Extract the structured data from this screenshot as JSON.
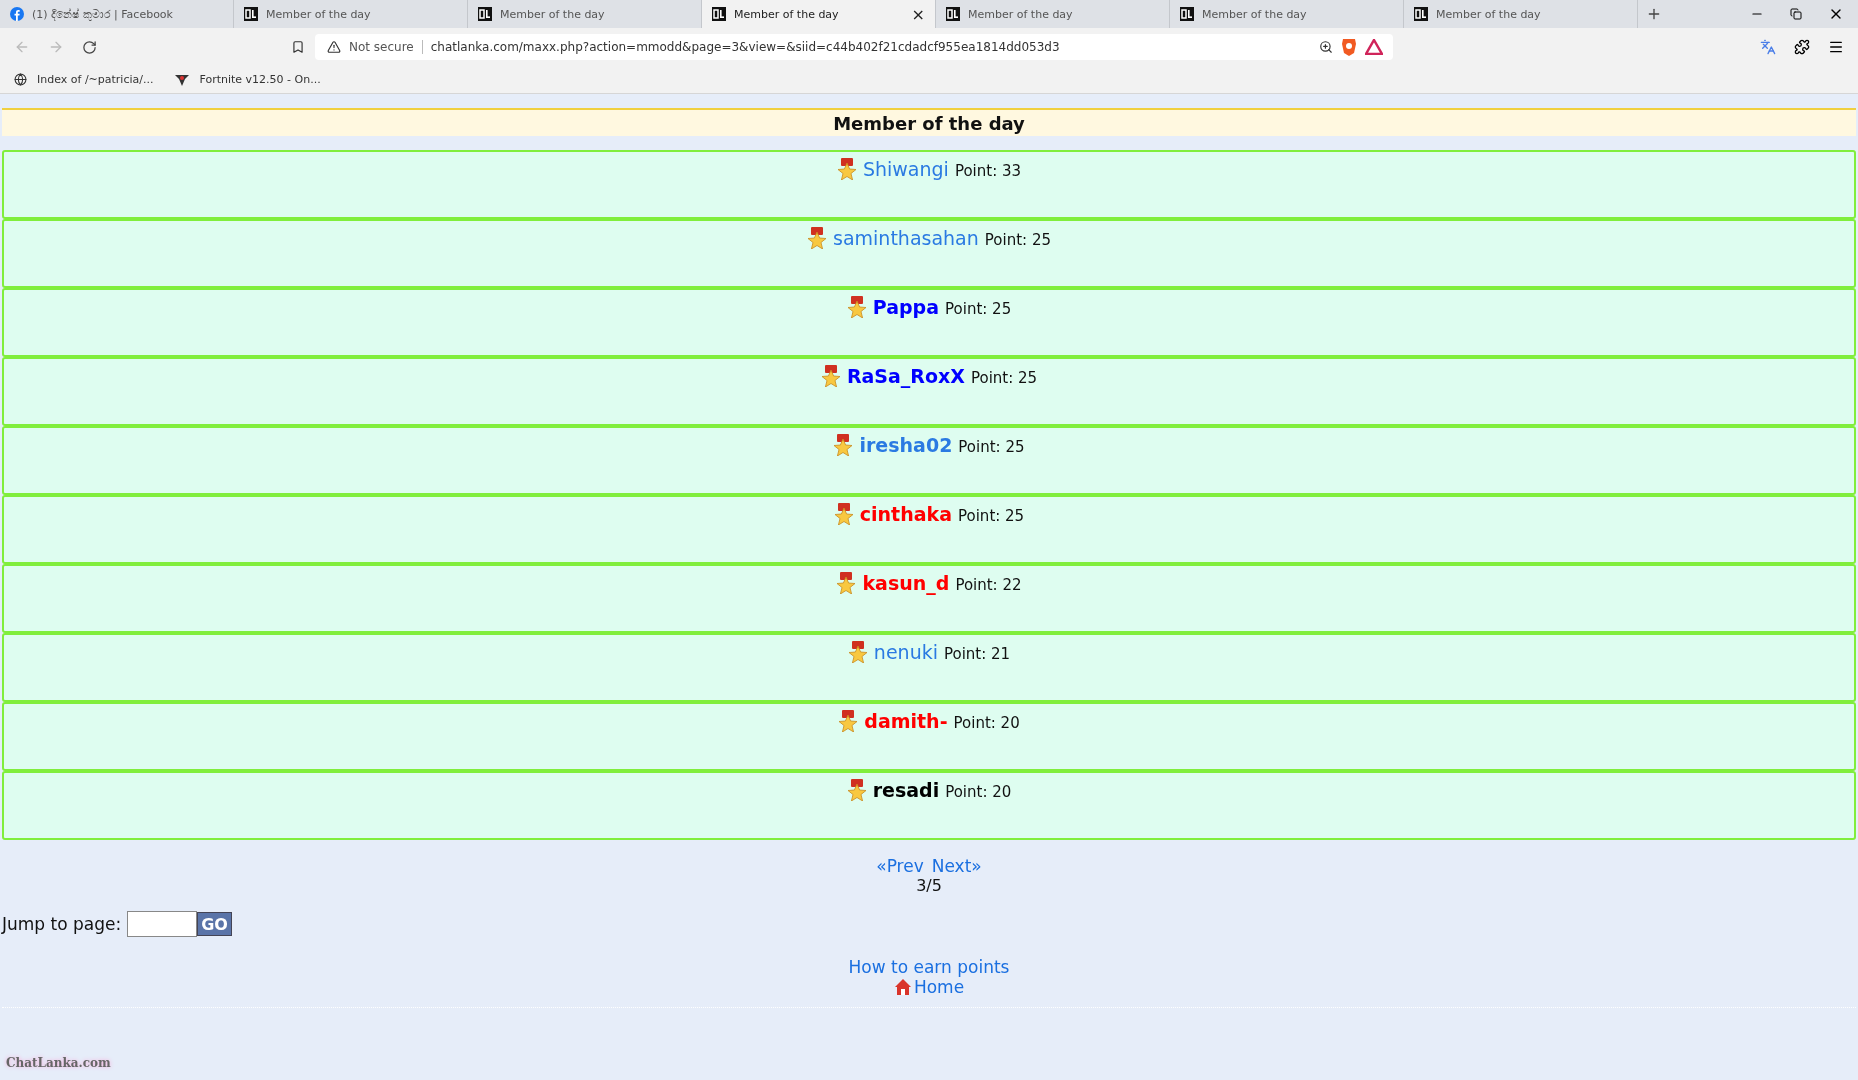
{
  "tabs": [
    {
      "kind": "facebook",
      "title": "(1) දිනේෂ් කුමාර | Facebook",
      "selected": false
    },
    {
      "kind": "site",
      "title": "Member of the day",
      "selected": false
    },
    {
      "kind": "site",
      "title": "Member of the day",
      "selected": false
    },
    {
      "kind": "site",
      "title": "Member of the day",
      "selected": true,
      "close": "×"
    },
    {
      "kind": "site",
      "title": "Member of the day",
      "selected": false
    },
    {
      "kind": "site",
      "title": "Member of the day",
      "selected": false
    },
    {
      "kind": "site",
      "title": "Member of the day",
      "selected": false
    }
  ],
  "address_bar": {
    "security": "Not secure",
    "url": "chatlanka.com/maxx.php?action=mmodd&page=3&view=&siid=c44b402f21cdadcf955ea1814dd053d3"
  },
  "bookmarks": [
    {
      "kind": "globe",
      "label": "Index of /~patricia/..."
    },
    {
      "kind": "game",
      "label": "Fortnite v12.50 - On..."
    }
  ],
  "page": {
    "heading": "Member of the day",
    "members": [
      {
        "name": "Shiwangi",
        "points": "Point: 33",
        "color": "#2a7ae2",
        "bold": false
      },
      {
        "name": "saminthasahan",
        "points": "Point: 25",
        "color": "#2a7ae2",
        "bold": false
      },
      {
        "name": "Pappa",
        "points": "Point: 25",
        "color": "#0000ff",
        "bold": true
      },
      {
        "name": "RaSa_RoxX",
        "points": "Point: 25",
        "color": "#0000ff",
        "bold": true
      },
      {
        "name": "iresha02",
        "points": "Point: 25",
        "color": "#2a7ae2",
        "bold": true
      },
      {
        "name": "cinthaka",
        "points": "Point: 25",
        "color": "#ff0000",
        "bold": true
      },
      {
        "name": "kasun_d",
        "points": "Point: 22",
        "color": "#ff0000",
        "bold": true
      },
      {
        "name": "nenuki",
        "points": "Point: 21",
        "color": "#2a7ae2",
        "bold": false
      },
      {
        "name": "damith-",
        "points": "Point: 20",
        "color": "#ff0000",
        "bold": true
      },
      {
        "name": "resadi",
        "points": "Point: 20",
        "color": "#000000",
        "bold": true
      }
    ],
    "pager": {
      "prev": "«Prev",
      "next": "Next»",
      "position": "3/5"
    },
    "jump": {
      "label": "Jump to page:",
      "button": "GO"
    },
    "earn_link": "How to earn points",
    "home_link": "Home",
    "logo": "ChatLanka.com"
  }
}
